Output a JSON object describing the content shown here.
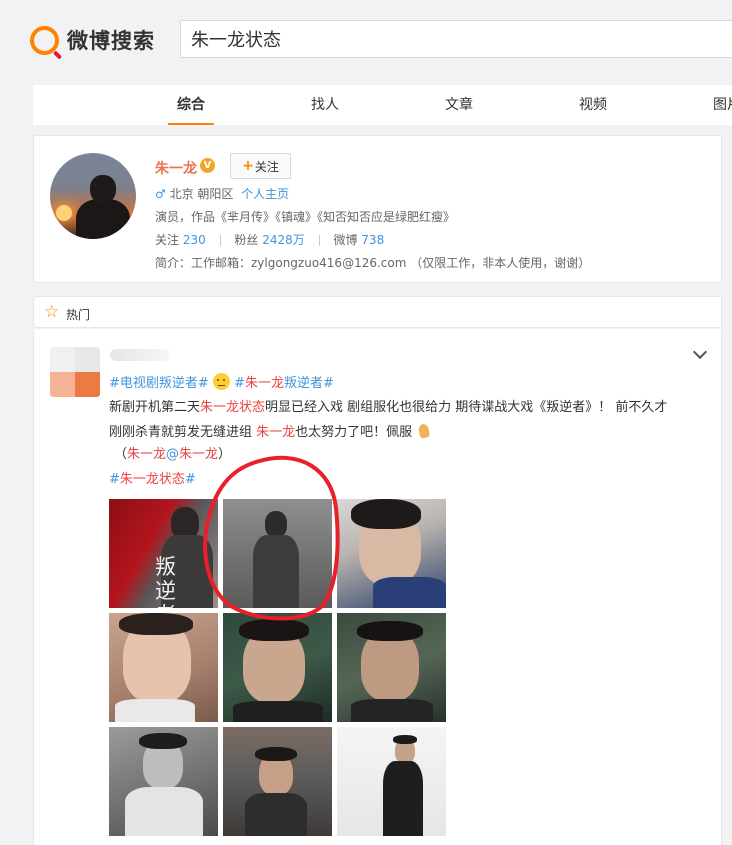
{
  "brand": {
    "name": "微博搜索"
  },
  "search": {
    "query": "朱一龙状态"
  },
  "tabs": [
    {
      "label": "综合",
      "active": true
    },
    {
      "label": "找人"
    },
    {
      "label": "文章"
    },
    {
      "label": "视频"
    },
    {
      "label": "图片"
    }
  ],
  "profile": {
    "name": "朱一龙",
    "verified_badge": "V",
    "follow_label": "关注",
    "gender_icon": "♂",
    "location": "北京 朝阳区",
    "homepage_link": "个人主页",
    "intro": "演员，作品《芈月传》《镇魂》《知否知否应是绿肥红瘦》",
    "stats": {
      "following_label": "关注",
      "following": "230",
      "fans_label": "粉丝",
      "fans": "2428万",
      "posts_label": "微博",
      "posts": "738"
    },
    "bio": "简介：工作邮箱：zylgongzuo416@126.com （仅限工作，非本人使用，谢谢）"
  },
  "hot": {
    "label": "热门"
  },
  "post": {
    "tag1": "#电视剧叛逆者#",
    "tag2_hash1": "#",
    "tag2_red": "朱一龙",
    "tag2_rest": "叛逆者#",
    "line1_a": "新剧开机第二天",
    "line1_red": "朱一龙状态",
    "line1_b": "明显已经入戏 剧组服化也很给力 期待谍战大戏《叛逆者》！ 前不久才",
    "line2_a": "刚刚杀青就剪发无缝进组 ",
    "line2_red": "朱一龙",
    "line2_b": "也太努力了吧！佩服",
    "line3_open": "（",
    "line3_red1": "朱一龙",
    "line3_at": "@",
    "line3_red2": "朱一龙",
    "line3_close": "）",
    "tag3_hash": "#",
    "tag3_red": "朱一龙状态",
    "tag3_end": "#",
    "photo1_caption": "叛逆者",
    "grid_count": 9
  },
  "colors": {
    "accent_orange": "#ff8200",
    "link_red": "#eb7350",
    "topic_blue": "#3f94df",
    "annotation_red": "#e8202a"
  }
}
